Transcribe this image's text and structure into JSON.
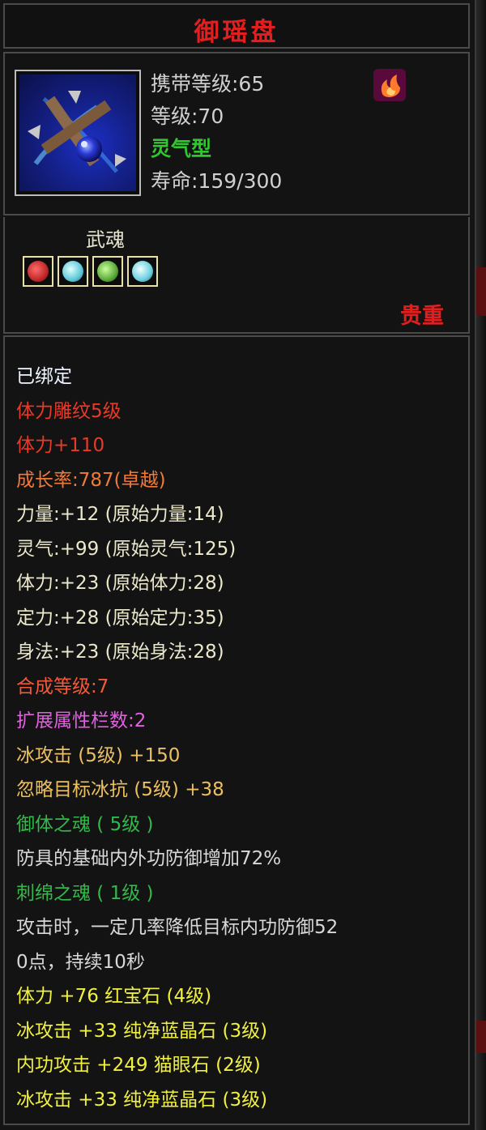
{
  "item": {
    "name": "御瑶盘",
    "rarity": "贵重",
    "carry_level": "携带等级:65",
    "level": "等级:70",
    "type": "灵气型",
    "lifespan": "寿命:159/300",
    "item_icon": "cross-blade-disc-icon",
    "badge_icon": "flame-crest-icon"
  },
  "wuhun": {
    "label": "武魂",
    "gems": [
      {
        "icon": "red-soul-gem-icon",
        "color": "#c0282a"
      },
      {
        "icon": "cyan-soul-gem-icon",
        "color": "#5ec8d8"
      },
      {
        "icon": "green-soul-gem-icon",
        "color": "#5aa83a"
      },
      {
        "icon": "cyan-soul-gem-icon",
        "color": "#6ad0e0"
      }
    ]
  },
  "lines": [
    {
      "text": "已绑定",
      "color": "white"
    },
    {
      "text": "体力雕纹5级",
      "color": "red"
    },
    {
      "text": "体力+110",
      "color": "red"
    },
    {
      "text": "成长率:787(卓越)",
      "color": "orange"
    },
    {
      "text": "力量:+12 (原始力量:14)",
      "color": "cream"
    },
    {
      "text": "灵气:+99 (原始灵气:125)",
      "color": "cream"
    },
    {
      "text": "体力:+23 (原始体力:28)",
      "color": "cream"
    },
    {
      "text": "定力:+28 (原始定力:35)",
      "color": "cream"
    },
    {
      "text": "身法:+23 (原始身法:28)",
      "color": "cream"
    },
    {
      "text": "合成等级:7",
      "color": "salmon"
    },
    {
      "text": "扩展属性栏数:2",
      "color": "pink"
    },
    {
      "text": "冰攻击 (5级) +150",
      "color": "gold"
    },
    {
      "text": "忽略目标冰抗 (5级) +38",
      "color": "gold"
    },
    {
      "text": "御体之魂 ( 5级 )",
      "color": "green"
    },
    {
      "text": "防具的基础内外功防御增加72%",
      "color": "grey"
    },
    {
      "text": "刺绵之魂 ( 1级 )",
      "color": "green"
    },
    {
      "text": "攻击时，一定几率降低目标内功防御52",
      "color": "grey"
    },
    {
      "text": "0点，持续10秒",
      "color": "grey"
    },
    {
      "text": "体力 +76 红宝石 (4级)",
      "color": "yellow"
    },
    {
      "text": "冰攻击 +33 纯净蓝晶石 (3级)",
      "color": "yellow"
    },
    {
      "text": "内功攻击 +249 猫眼石 (2级)",
      "color": "yellow"
    },
    {
      "text": "冰攻击 +33 纯净蓝晶石 (3级)",
      "color": "yellow"
    }
  ]
}
